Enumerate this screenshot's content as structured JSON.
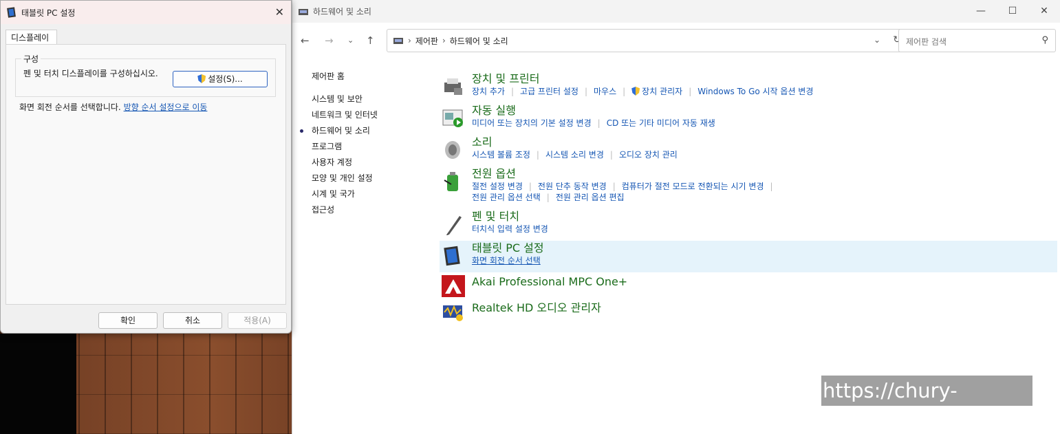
{
  "dialog": {
    "title": "태블릿 PC 설정",
    "tab": "디스플레이",
    "group_label": "구성",
    "group_text": "펜 및 터치 디스플레이를 구성하십시오.",
    "setup_button": "설정(S)...",
    "rotation_text": "화면 회전 순서를 선택합니다.",
    "rotation_link": "방향 순서 설정으로 이동",
    "ok": "확인",
    "cancel": "취소",
    "apply": "적용(A)"
  },
  "window": {
    "title": "하드웨어 및 소리",
    "breadcrumb": [
      "제어판",
      "하드웨어 및 소리"
    ],
    "search_placeholder": "제어판 검색"
  },
  "sidebar": {
    "home": "제어판 홈",
    "items": [
      "시스템 및 보안",
      "네트워크 및 인터넷",
      "하드웨어 및 소리",
      "프로그램",
      "사용자 계정",
      "모양 및 개인 설정",
      "시계 및 국가",
      "접근성"
    ],
    "current_index": 2
  },
  "categories": [
    {
      "title": "장치 및 프린터",
      "links": [
        "장치 추가",
        "고급 프린터 설정",
        "마우스",
        "장치 관리자",
        "Windows To Go 시작 옵션 변경"
      ]
    },
    {
      "title": "자동 실행",
      "links": [
        "미디어 또는 장치의 기본 설정 변경",
        "CD 또는 기타 미디어 자동 재생"
      ]
    },
    {
      "title": "소리",
      "links": [
        "시스템 볼륨 조정",
        "시스템 소리 변경",
        "오디오 장치 관리"
      ]
    },
    {
      "title": "전원 옵션",
      "links": [
        "절전 설정 변경",
        "전원 단추 동작 변경",
        "컴퓨터가 절전 모드로 전환되는 시기 변경"
      ],
      "links2": [
        "전원 관리 옵션 선택",
        "전원 관리 옵션 편집"
      ]
    },
    {
      "title": "펜 및 터치",
      "links": [
        "터치식 입력 설정 변경"
      ]
    },
    {
      "title": "태블릿 PC 설정",
      "links": [
        "화면 회전 순서 선택"
      ]
    },
    {
      "title": "Akai Professional MPC One+",
      "links": []
    },
    {
      "title": "Realtek HD 오디오 관리자",
      "links": []
    }
  ],
  "watermark": "https://chury-true.com",
  "colors": {
    "link": "#1556b3",
    "category": "#1a6b1a",
    "highlight": "#e5f3fb"
  }
}
